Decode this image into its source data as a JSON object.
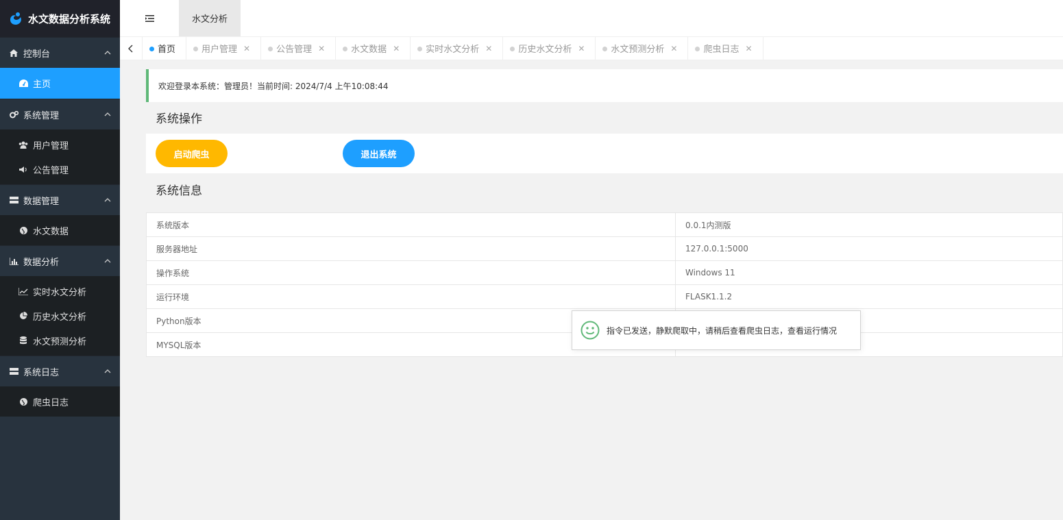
{
  "app": {
    "title": "水文数据分析系统",
    "accent_color": "#1e9fff"
  },
  "topbar": {
    "menu_icon": "menu-fold-icon",
    "active_tab": "水文分析"
  },
  "sidebar": {
    "groups": [
      {
        "label": "控制台",
        "icon": "home-icon",
        "items": [
          {
            "label": "主页",
            "icon": "dashboard-icon",
            "active": true
          }
        ]
      },
      {
        "label": "系统管理",
        "icon": "gears-icon",
        "items": [
          {
            "label": "用户管理",
            "icon": "users-icon"
          },
          {
            "label": "公告管理",
            "icon": "volume-icon"
          }
        ]
      },
      {
        "label": "数据管理",
        "icon": "server-icon",
        "items": [
          {
            "label": "水文数据",
            "icon": "globe-icon"
          }
        ]
      },
      {
        "label": "数据分析",
        "icon": "bar-chart-icon",
        "items": [
          {
            "label": "实时水文分析",
            "icon": "line-chart-icon"
          },
          {
            "label": "历史水文分析",
            "icon": "pie-chart-icon"
          },
          {
            "label": "水文预测分析",
            "icon": "database-icon"
          }
        ]
      },
      {
        "label": "系统日志",
        "icon": "server-icon",
        "items": [
          {
            "label": "爬虫日志",
            "icon": "globe-icon"
          }
        ]
      }
    ]
  },
  "tabs": [
    {
      "label": "首页",
      "active": true
    },
    {
      "label": "用户管理"
    },
    {
      "label": "公告管理"
    },
    {
      "label": "水文数据"
    },
    {
      "label": "实时水文分析"
    },
    {
      "label": "历史水文分析"
    },
    {
      "label": "水文预测分析"
    },
    {
      "label": "爬虫日志"
    }
  ],
  "welcome": {
    "prefix": "欢迎登录本系统：",
    "user": "管理员！当前时间: 2024/7/4 上午10:08:44"
  },
  "operations": {
    "title": "系统操作",
    "start_crawler": "启动爬虫",
    "logout": "退出系统",
    "start_color": "#ffb800",
    "logout_color": "#1e9fff"
  },
  "info": {
    "title": "系统信息",
    "rows": [
      {
        "key": "系统版本",
        "value": "0.0.1内测版"
      },
      {
        "key": "服务器地址",
        "value": "127.0.0.1:5000"
      },
      {
        "key": "操作系统",
        "value": "Windows 11"
      },
      {
        "key": "运行环境",
        "value": "FLASK1.1.2"
      },
      {
        "key": "Python版本",
        "value": ""
      },
      {
        "key": "MYSQL版本",
        "value": ""
      }
    ]
  },
  "toast": {
    "icon": "smile-icon",
    "message": "指令已发送，静默爬取中，请稍后查看爬虫日志，查看运行情况"
  }
}
